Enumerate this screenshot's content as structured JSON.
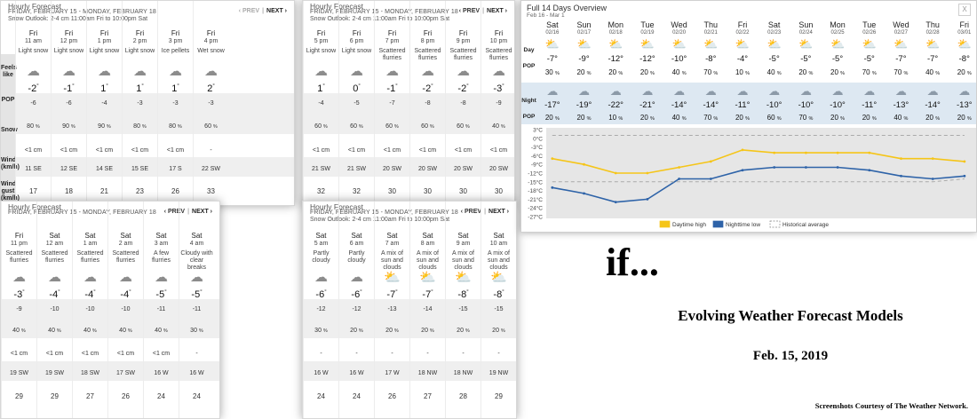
{
  "colors": {
    "daytime_high": "#f5c518",
    "nighttime_low": "#2e63a8",
    "historical": "#aaaaaa",
    "night_band": "#dde8f2"
  },
  "panels": [
    {
      "title": "Hourly Forecast",
      "range": "FRIDAY, FEBRUARY 15 - MONDAY, FEBRUARY 18",
      "outlook": "Snow Outlook: 2-4 cm 11:00am Fri to 10:00pm Sat",
      "prev": "‹ PREV",
      "prev_dim": true,
      "next": "NEXT ›",
      "labels": [
        "Feels like",
        "POP",
        "Snow",
        "Wind (km/h)",
        "Wind gust (km/h)"
      ],
      "columns": [
        {
          "day": "Fri",
          "time": "11 am",
          "cond": "Light snow",
          "icon": "snow-icon",
          "temp": "-2",
          "feels": "-6",
          "pop": "80",
          "snow": "<1 cm",
          "wind": "11 SE",
          "gust": "17"
        },
        {
          "day": "Fri",
          "time": "12 pm",
          "cond": "Light snow",
          "icon": "snow-icon",
          "temp": "-1",
          "feels": "-6",
          "pop": "90",
          "snow": "<1 cm",
          "wind": "12 SE",
          "gust": "18"
        },
        {
          "day": "Fri",
          "time": "1 pm",
          "cond": "Light snow",
          "icon": "snow-icon",
          "temp": "1",
          "feels": "-4",
          "pop": "90",
          "snow": "<1 cm",
          "wind": "14 SE",
          "gust": "21"
        },
        {
          "day": "Fri",
          "time": "2 pm",
          "cond": "Light snow",
          "icon": "snow-icon",
          "temp": "1",
          "feels": "-3",
          "pop": "80",
          "snow": "<1 cm",
          "wind": "15 SE",
          "gust": "23"
        },
        {
          "day": "Fri",
          "time": "3 pm",
          "cond": "Ice pellets",
          "icon": "ice-pellets-icon",
          "temp": "1",
          "feels": "-3",
          "pop": "80",
          "snow": "<1 cm",
          "wind": "17 S",
          "gust": "26"
        },
        {
          "day": "Fri",
          "time": "4 pm",
          "cond": "Wet snow",
          "icon": "wet-snow-icon",
          "temp": "2",
          "feels": "-3",
          "pop": "60",
          "snow": "-",
          "wind": "22 SW",
          "gust": "33"
        }
      ]
    },
    {
      "title": "Hourly Forecast",
      "range": "FRIDAY, FEBRUARY 15 - MONDAY, FEBRUARY 18",
      "outlook": "Snow Outlook: 2-4 cm 11:00am Fri to 10:00pm Sat",
      "prev": "‹ PREV",
      "prev_dim": false,
      "next": "NEXT ›",
      "columns": [
        {
          "day": "Fri",
          "time": "5 pm",
          "cond": "Light snow",
          "icon": "snow-icon",
          "temp": "1",
          "feels": "-4",
          "pop": "60",
          "snow": "<1 cm",
          "wind": "21 SW",
          "gust": "32"
        },
        {
          "day": "Fri",
          "time": "6 pm",
          "cond": "Light snow",
          "icon": "snow-icon",
          "temp": "0",
          "feels": "-5",
          "pop": "60",
          "snow": "<1 cm",
          "wind": "21 SW",
          "gust": "32"
        },
        {
          "day": "Fri",
          "time": "7 pm",
          "cond": "Scattered flurries",
          "icon": "snow-icon",
          "temp": "-1",
          "feels": "-7",
          "pop": "60",
          "snow": "<1 cm",
          "wind": "20 SW",
          "gust": "30"
        },
        {
          "day": "Fri",
          "time": "8 pm",
          "cond": "Scattered flurries",
          "icon": "snow-icon",
          "temp": "-2",
          "feels": "-8",
          "pop": "60",
          "snow": "<1 cm",
          "wind": "20 SW",
          "gust": "30"
        },
        {
          "day": "Fri",
          "time": "9 pm",
          "cond": "Scattered flurries",
          "icon": "snow-icon",
          "temp": "-2",
          "feels": "-8",
          "pop": "60",
          "snow": "<1 cm",
          "wind": "20 SW",
          "gust": "30"
        },
        {
          "day": "Fri",
          "time": "10 pm",
          "cond": "Scattered flurries",
          "icon": "snow-icon",
          "temp": "-3",
          "feels": "-9",
          "pop": "40",
          "snow": "<1 cm",
          "wind": "20 SW",
          "gust": "30"
        }
      ]
    },
    {
      "title": "Hourly Forecast",
      "range": "FRIDAY, FEBRUARY 15 - MONDAY, FEBRUARY 18",
      "outlook": "",
      "prev": "‹ PREV",
      "prev_dim": false,
      "next": "NEXT ›",
      "columns": [
        {
          "day": "Fri",
          "time": "11 pm",
          "cond": "Scattered flurries",
          "icon": "snow-icon",
          "temp": "-3",
          "feels": "-9",
          "pop": "40",
          "snow": "<1 cm",
          "wind": "19 SW",
          "gust": "29"
        },
        {
          "day": "Sat",
          "time": "12 am",
          "cond": "Scattered flurries",
          "icon": "snow-icon",
          "temp": "-4",
          "feels": "-10",
          "pop": "40",
          "snow": "<1 cm",
          "wind": "19 SW",
          "gust": "29"
        },
        {
          "day": "Sat",
          "time": "1 am",
          "cond": "Scattered flurries",
          "icon": "snow-icon",
          "temp": "-4",
          "feels": "-10",
          "pop": "40",
          "snow": "<1 cm",
          "wind": "18 SW",
          "gust": "27"
        },
        {
          "day": "Sat",
          "time": "2 am",
          "cond": "Scattered flurries",
          "icon": "snow-icon",
          "temp": "-4",
          "feels": "-10",
          "pop": "40",
          "snow": "<1 cm",
          "wind": "17 SW",
          "gust": "26"
        },
        {
          "day": "Sat",
          "time": "3 am",
          "cond": "A few flurries",
          "icon": "snow-icon",
          "temp": "-5",
          "feels": "-11",
          "pop": "40",
          "snow": "<1 cm",
          "wind": "16 W",
          "gust": "24"
        },
        {
          "day": "Sat",
          "time": "4 am",
          "cond": "Cloudy with clear breaks",
          "icon": "cloud-icon",
          "temp": "-5",
          "feels": "-11",
          "pop": "30",
          "snow": "-",
          "wind": "16 W",
          "gust": "24"
        }
      ]
    },
    {
      "title": "Hourly Forecast",
      "range": "FRIDAY, FEBRUARY 15 - MONDAY, FEBRUARY 18",
      "outlook": "Snow Outlook: 2-4 cm 11:00am Fri to 10:00pm Sat",
      "prev": "‹ PREV",
      "prev_dim": false,
      "next": "NEXT ›",
      "columns": [
        {
          "day": "Sat",
          "time": "5 am",
          "cond": "Partly cloudy",
          "icon": "partly-cloudy-icon",
          "temp": "-6",
          "feels": "-12",
          "pop": "30",
          "snow": "-",
          "wind": "16 W",
          "gust": "24"
        },
        {
          "day": "Sat",
          "time": "6 am",
          "cond": "Partly cloudy",
          "icon": "partly-cloudy-icon",
          "temp": "-6",
          "feels": "-12",
          "pop": "20",
          "snow": "-",
          "wind": "16 W",
          "gust": "24"
        },
        {
          "day": "Sat",
          "time": "7 am",
          "cond": "A mix of sun and clouds",
          "icon": "sun-cloud-icon",
          "temp": "-7",
          "feels": "-13",
          "pop": "20",
          "snow": "-",
          "wind": "17 W",
          "gust": "26"
        },
        {
          "day": "Sat",
          "time": "8 am",
          "cond": "A mix of sun and clouds",
          "icon": "sun-cloud-icon",
          "temp": "-7",
          "feels": "-14",
          "pop": "20",
          "snow": "-",
          "wind": "18 NW",
          "gust": "27"
        },
        {
          "day": "Sat",
          "time": "9 am",
          "cond": "A mix of sun and clouds",
          "icon": "sun-cloud-icon",
          "temp": "-8",
          "feels": "-15",
          "pop": "20",
          "snow": "-",
          "wind": "18 NW",
          "gust": "28"
        },
        {
          "day": "Sat",
          "time": "10 am",
          "cond": "A mix of sun and clouds",
          "icon": "sun-cloud-icon",
          "temp": "-8",
          "feels": "-15",
          "pop": "20",
          "snow": "-",
          "wind": "19 NW",
          "gust": "29"
        }
      ]
    }
  ],
  "overview": {
    "title": "Full 14 Days Overview",
    "subtitle": "Feb 16 - Mar 1",
    "close": "X",
    "labels": {
      "day": "Day",
      "pop": "POP",
      "night": "Night",
      "pop2": "POP"
    },
    "days": [
      {
        "day": "Sat",
        "date": "02/16",
        "day_temp": "-7",
        "day_pop": "30",
        "night_temp": "-17",
        "night_pop": "20"
      },
      {
        "day": "Sun",
        "date": "02/17",
        "day_temp": "-9",
        "day_pop": "20",
        "night_temp": "-19",
        "night_pop": "20"
      },
      {
        "day": "Mon",
        "date": "02/18",
        "day_temp": "-12",
        "day_pop": "20",
        "night_temp": "-22",
        "night_pop": "10"
      },
      {
        "day": "Tue",
        "date": "02/19",
        "day_temp": "-12",
        "day_pop": "20",
        "night_temp": "-21",
        "night_pop": "20"
      },
      {
        "day": "Wed",
        "date": "02/20",
        "day_temp": "-10",
        "day_pop": "40",
        "night_temp": "-14",
        "night_pop": "40"
      },
      {
        "day": "Thu",
        "date": "02/21",
        "day_temp": "-8",
        "day_pop": "70",
        "night_temp": "-14",
        "night_pop": "70"
      },
      {
        "day": "Fri",
        "date": "02/22",
        "day_temp": "-4",
        "day_pop": "10",
        "night_temp": "-11",
        "night_pop": "20"
      },
      {
        "day": "Sat",
        "date": "02/23",
        "day_temp": "-5",
        "day_pop": "40",
        "night_temp": "-10",
        "night_pop": "60"
      },
      {
        "day": "Sun",
        "date": "02/24",
        "day_temp": "-5",
        "day_pop": "20",
        "night_temp": "-10",
        "night_pop": "70"
      },
      {
        "day": "Mon",
        "date": "02/25",
        "day_temp": "-5",
        "day_pop": "20",
        "night_temp": "-10",
        "night_pop": "20"
      },
      {
        "day": "Tue",
        "date": "02/26",
        "day_temp": "-5",
        "day_pop": "70",
        "night_temp": "-11",
        "night_pop": "20"
      },
      {
        "day": "Wed",
        "date": "02/27",
        "day_temp": "-7",
        "day_pop": "70",
        "night_temp": "-13",
        "night_pop": "40"
      },
      {
        "day": "Thu",
        "date": "02/28",
        "day_temp": "-7",
        "day_pop": "40",
        "night_temp": "-14",
        "night_pop": "20"
      },
      {
        "day": "Fri",
        "date": "03/01",
        "day_temp": "-8",
        "day_pop": "20",
        "night_temp": "-13",
        "night_pop": "20"
      }
    ],
    "legend": [
      "Daytime high",
      "Nighttime low",
      "Historical average"
    ]
  },
  "chart_data": {
    "type": "line",
    "x": [
      "02/16",
      "02/17",
      "02/18",
      "02/19",
      "02/20",
      "02/21",
      "02/22",
      "02/23",
      "02/24",
      "02/25",
      "02/26",
      "02/27",
      "02/28",
      "03/01"
    ],
    "series": [
      {
        "name": "Daytime high",
        "values": [
          -7,
          -9,
          -12,
          -12,
          -10,
          -8,
          -4,
          -5,
          -5,
          -5,
          -5,
          -7,
          -7,
          -8
        ]
      },
      {
        "name": "Nighttime low",
        "values": [
          -17,
          -19,
          -22,
          -21,
          -14,
          -14,
          -11,
          -10,
          -10,
          -10,
          -11,
          -13,
          -14,
          -13
        ]
      },
      {
        "name": "Historical average",
        "values": [
          1,
          1,
          1,
          1,
          1,
          1,
          1,
          1,
          1,
          1,
          1,
          1,
          1,
          1
        ]
      },
      {
        "name": "Historical average",
        "values": [
          -15,
          -15,
          -15,
          -15,
          -15,
          -15,
          -15,
          -15,
          -15,
          -15,
          -15,
          -15,
          -15,
          -14
        ]
      }
    ],
    "y_ticks": [
      "3°C",
      "0°C",
      "-3°C",
      "-6°C",
      "-9°C",
      "-12°C",
      "-15°C",
      "-18°C",
      "-21°C",
      "-24°C",
      "-27°C"
    ],
    "ylim": [
      -27,
      3
    ],
    "legend_position": "bottom"
  },
  "text": {
    "if": "if...",
    "title": "Evolving Weather Forecast Models",
    "date": "Feb. 15, 2019",
    "credit": "Screenshots Courtesy of The Weather Network."
  }
}
